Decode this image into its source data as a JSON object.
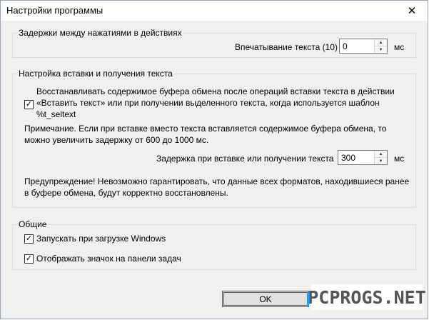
{
  "window": {
    "title": "Настройки программы",
    "close_glyph": "✕"
  },
  "delays": {
    "group_label": "Задержки между нажатиями в действиях",
    "typing_label": "Впечатывание текста (10)",
    "typing_value": "0",
    "typing_unit": "мс"
  },
  "paste": {
    "group_label": "Настройка вставки и получения текста",
    "restore_checked": true,
    "restore_lines": [
      "Восстанавливать содержимое буфера обмена после операций вставки текста в действии",
      "«Вставить текст» или при получении выделенного текста, когда используется шаблон",
      "%t_seltext"
    ],
    "note_lines": [
      "Примечание. Если при вставке вместо текста вставляется содержимое буфера обмена, то",
      "можно увеличить задержку от 600 до 1000 мс."
    ],
    "delay_label": "Задержка при вставке или получении текста",
    "delay_value": "300",
    "delay_unit": "мс",
    "warning_lines": [
      "Предупреждение! Невозможно гарантировать, что данные всех форматов, находившиеся ранее",
      "в буфере обмена, будут корректно восстановлены."
    ]
  },
  "general": {
    "group_label": "Общие",
    "startup_label": "Запускать при загрузке Windows",
    "startup_checked": true,
    "tray_label": "Отображать значок на панели задач",
    "tray_checked": true
  },
  "buttons": {
    "ok_label": "OK"
  },
  "watermark": "PCPROGS.NET",
  "icons": {
    "check": "✓",
    "spin_up": "▲",
    "spin_down": "▼"
  }
}
